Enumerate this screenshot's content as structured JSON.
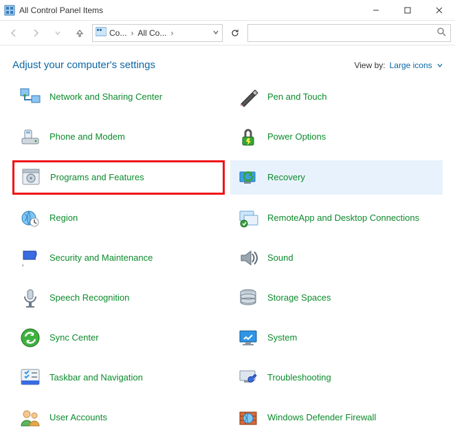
{
  "window": {
    "title": "All Control Panel Items"
  },
  "address": {
    "crumb1": "Co...",
    "crumb2": "All Co..."
  },
  "search": {
    "placeholder": ""
  },
  "header": {
    "heading": "Adjust your computer's settings",
    "viewby_label": "View by:",
    "viewby_value": "Large icons"
  },
  "items": {
    "left": [
      {
        "label": "Network and Sharing Center"
      },
      {
        "label": "Phone and Modem"
      },
      {
        "label": "Programs and Features"
      },
      {
        "label": "Region"
      },
      {
        "label": "Security and Maintenance"
      },
      {
        "label": "Speech Recognition"
      },
      {
        "label": "Sync Center"
      },
      {
        "label": "Taskbar and Navigation"
      },
      {
        "label": "User Accounts"
      }
    ],
    "right": [
      {
        "label": "Pen and Touch"
      },
      {
        "label": "Power Options"
      },
      {
        "label": "Recovery"
      },
      {
        "label": "RemoteApp and Desktop Connections"
      },
      {
        "label": "Sound"
      },
      {
        "label": "Storage Spaces"
      },
      {
        "label": "System"
      },
      {
        "label": "Troubleshooting"
      },
      {
        "label": "Windows Defender Firewall"
      }
    ]
  }
}
